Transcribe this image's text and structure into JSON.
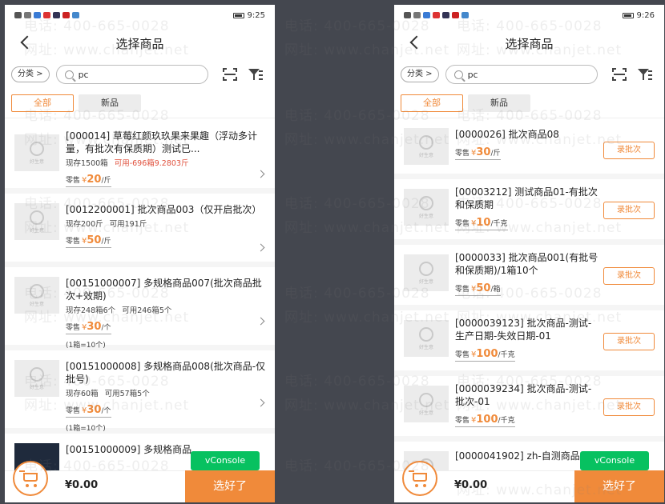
{
  "screens": [
    {
      "status_time": "9:25",
      "title": "选择商品",
      "category_label": "分类 >",
      "search_value": "pc",
      "tabs": [
        "全部",
        "新品"
      ],
      "items": [
        {
          "name": "[000014] 草莓红颜玖玖果来果趣（浮动多计量，有批次有保质期）测试已...",
          "stock": "现存1500箱",
          "available": "可用-696箱9.2803斤",
          "price_label": "零售",
          "price_symbol": "¥",
          "price": "20",
          "unit": "/斤",
          "note": ""
        },
        {
          "name": "[0012200001] 批次商品003（仅开启批次）",
          "stock": "现存200斤",
          "available": "可用191斤",
          "price_label": "零售",
          "price_symbol": "¥",
          "price": "50",
          "unit": "/斤",
          "note": ""
        },
        {
          "name": "[00151000007] 多规格商品007(批次商品批次+效期)",
          "stock": "现存248箱6个",
          "available": "可用246箱5个",
          "price_label": "零售",
          "price_symbol": "¥",
          "price": "30",
          "unit": "/个",
          "note": "(1箱=10个)"
        },
        {
          "name": "[00151000008] 多规格商品008(批次商品-仅批号)",
          "stock": "现存60箱",
          "available": "可用57箱5个",
          "price_label": "零售",
          "price_symbol": "¥",
          "price": "30",
          "unit": "/个",
          "note": "(1箱=10个)"
        },
        {
          "name": "[00151000009] 多规格商品",
          "stock": "",
          "available": "",
          "price_label": "",
          "price_symbol": "",
          "price": "",
          "unit": "",
          "note": ""
        }
      ],
      "vconsole_label": "vConsole",
      "total": "¥0.00",
      "done_label": "选好了"
    },
    {
      "status_time": "9:26",
      "title": "选择商品",
      "category_label": "分类 >",
      "search_value": "pc",
      "tabs": [
        "全部",
        "新品"
      ],
      "items": [
        {
          "name": "[0000026] 批次商品08",
          "price_label": "零售",
          "price_symbol": "¥",
          "price": "30",
          "unit": "/斤",
          "action": "录批次"
        },
        {
          "name": "[00003212] 测试商品01-有批次和保质期",
          "price_label": "零售",
          "price_symbol": "¥",
          "price": "10",
          "unit": "/千克",
          "action": "录批次"
        },
        {
          "name": "[0000033] 批次商品001(有批号和保质期)/1箱10个",
          "price_label": "零售",
          "price_symbol": "¥",
          "price": "50",
          "unit": "/箱",
          "action": "录批次"
        },
        {
          "name": "[0000039123] 批次商品-测试-生产日期-失效日期-01",
          "price_label": "零售",
          "price_symbol": "¥",
          "price": "100",
          "unit": "/千克",
          "action": "录批次"
        },
        {
          "name": "[0000039234] 批次商品-测试-批次-01",
          "price_label": "零售",
          "price_symbol": "¥",
          "price": "100",
          "unit": "/千克",
          "action": "录批次"
        },
        {
          "name": "[0000041902] zh-自测商品",
          "price_label": "",
          "price_symbol": "",
          "price": "",
          "unit": "",
          "action": ""
        }
      ],
      "vconsole_label": "vConsole",
      "total": "¥0.00",
      "done_label": "选好了"
    }
  ],
  "watermark": {
    "phone": "电话: 400-665-0028",
    "site": "网址: www.chanjet.net"
  },
  "colors": {
    "accent": "#f08a3a",
    "vconsole": "#07c160",
    "warn": "#e0503c"
  }
}
